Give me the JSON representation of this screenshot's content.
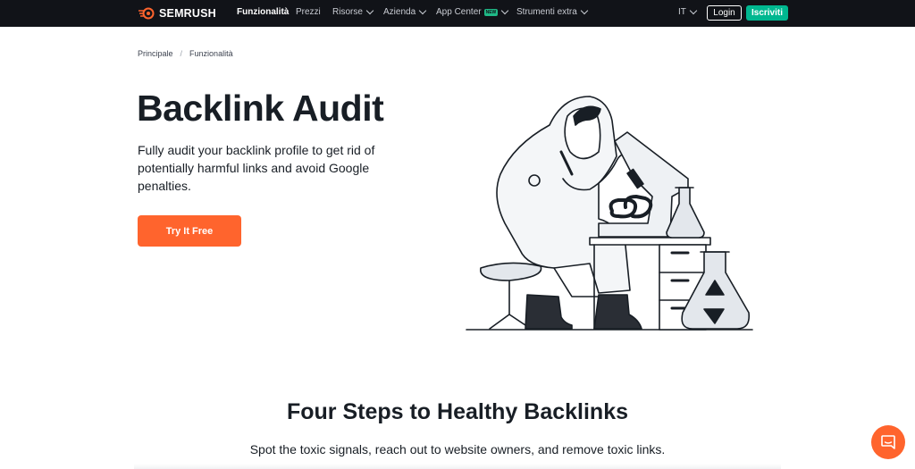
{
  "header": {
    "logo_text": "SEMRUSH",
    "nav": [
      {
        "label": "Funzionalità",
        "active": true
      },
      {
        "label": "Prezzi"
      },
      {
        "label": "Risorse"
      },
      {
        "label": "Azienda"
      },
      {
        "label": "App Center",
        "badge": "NEW"
      },
      {
        "label": "Strumenti extra"
      }
    ],
    "language": "IT",
    "login_label": "Login",
    "signup_label": "Iscriviti"
  },
  "breadcrumb": {
    "items": [
      "Principale",
      "Funzionalità"
    ],
    "separator": "/"
  },
  "hero": {
    "title": "Backlink Audit",
    "description": "Fully audit your backlink profile to get rid of potentially harmful links and avoid Google penalties.",
    "cta_label": "Try It Free"
  },
  "section": {
    "title": "Four Steps to Healthy Backlinks",
    "subtitle": "Spot the toxic signals, reach out to website owners, and remove toxic links."
  },
  "icons": {
    "logo": "semrush-flame-icon",
    "chevron": "chevron-down-icon",
    "chat": "chat-bubble-icon"
  },
  "colors": {
    "topbar": "#111318",
    "accent": "#ff642d",
    "signup": "#00b790",
    "text": "#181e25"
  }
}
